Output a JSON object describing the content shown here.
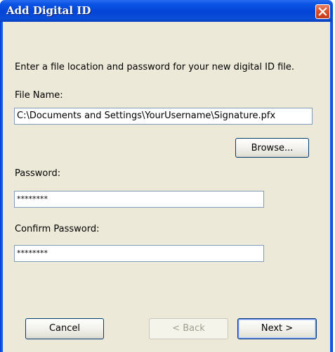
{
  "window": {
    "title": "Add Digital ID"
  },
  "instructions": "Enter a file location and password for your new digital ID file.",
  "file_name": {
    "label": "File Name:",
    "value": "C:\\Documents and Settings\\YourUsername\\Signature.pfx"
  },
  "browse_button": "Browse...",
  "password": {
    "label": "Password:",
    "masked_value": "********"
  },
  "confirm_password": {
    "label": "Confirm Password:",
    "masked_value": "********"
  },
  "buttons": {
    "cancel": "Cancel",
    "back": "< Back",
    "next": "Next >"
  },
  "icons": {
    "close": "close-icon"
  },
  "colors": {
    "titlebar": "#0a55e6",
    "client_background": "#ece9d8",
    "close_button": "#d9512c",
    "field_border": "#7f9db9",
    "button_border": "#003c74"
  }
}
